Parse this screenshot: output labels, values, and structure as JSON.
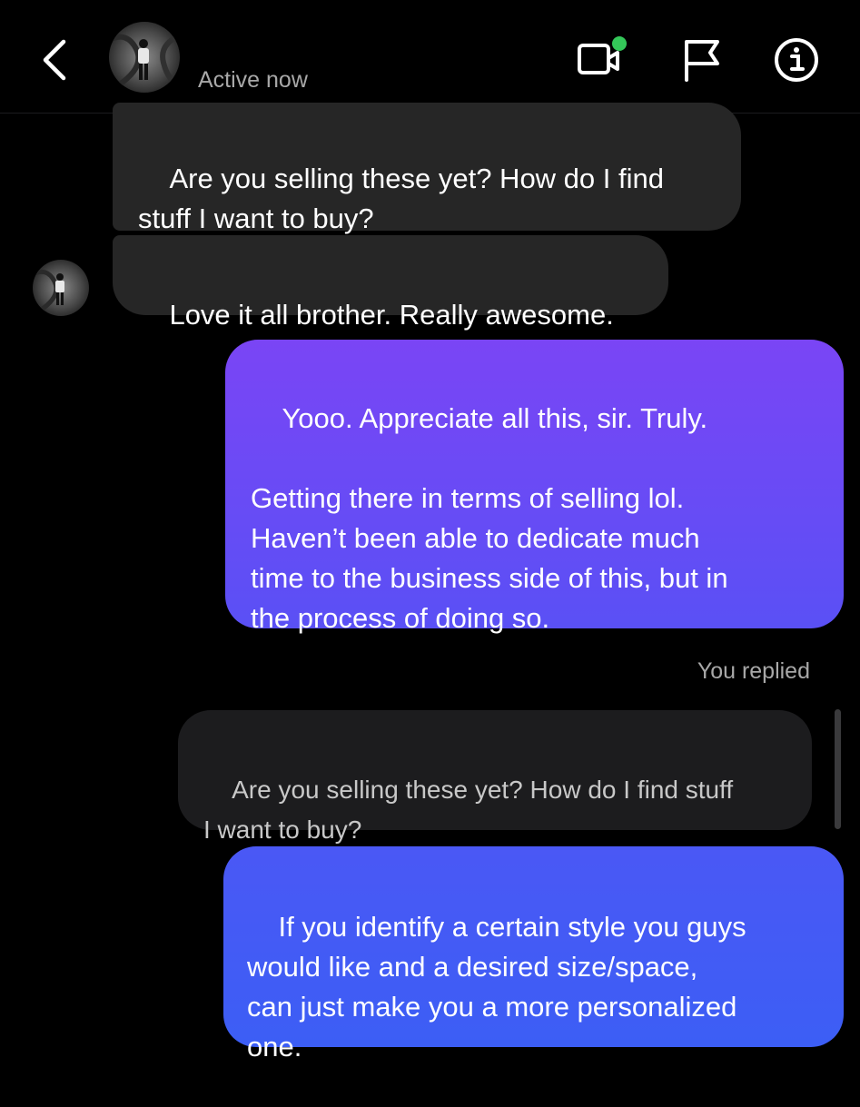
{
  "header": {
    "back_icon": "chevron-left-icon",
    "status": "Active now",
    "video_call_icon": "video-call-icon",
    "flag_icon": "flag-icon",
    "info_icon": "info-icon",
    "online_dot_color": "#34c759"
  },
  "messages": [
    {
      "direction": "incoming",
      "text": "Are you selling these yet? How do I find\nstuff I want to buy?"
    },
    {
      "direction": "incoming",
      "text": "Love it all brother. Really awesome."
    },
    {
      "direction": "outgoing",
      "text": "Yooo. Appreciate all this, sir. Truly.\n\nGetting there in terms of selling lol.\nHaven’t been able to dedicate much\ntime to the business side of this, but in\nthe process of doing so."
    },
    {
      "direction": "outgoing",
      "replied_label": "You replied",
      "quoted_text": "Are you selling these yet? How do I find stuff\nI want to buy?",
      "text": "If you identify a certain style you guys\nwould like and a desired size/space,\ncan just make you a more personalized\none."
    }
  ],
  "colors": {
    "background": "#000000",
    "incoming_bubble": "#262626",
    "outgoing_gradient_top": "#7a45f5",
    "outgoing_gradient_bottom": "#3c5ef5",
    "secondary_text": "#a8a8a8"
  }
}
